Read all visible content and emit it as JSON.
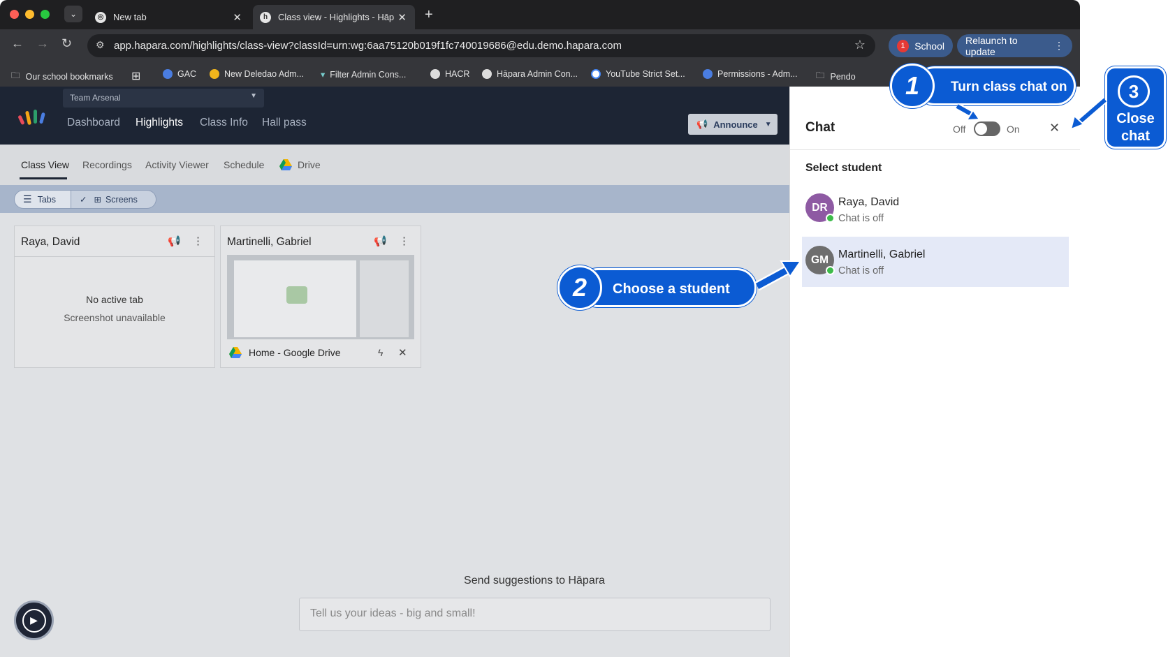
{
  "browser": {
    "tabs": [
      {
        "title": "New tab"
      },
      {
        "title": "Class view - Highlights - Hāp"
      }
    ],
    "url": "app.hapara.com/highlights/class-view?classId=urn:wg:6aa75120b019f1fc740019686@edu.demo.hapara.com",
    "profile_badge": "1",
    "profile_label": "School",
    "relaunch_label": "Relaunch to update",
    "bookmarks": [
      "Our school bookmarks",
      "GAC",
      "New Deledao Adm...",
      "Filter Admin Cons...",
      "HACR",
      "Hāpara Admin Con...",
      "YouTube Strict Set...",
      "Permissions - Adm...",
      "Pendo"
    ]
  },
  "app": {
    "team_select": "Team Arsenal",
    "nav": [
      "Dashboard",
      "Highlights",
      "Class Info",
      "Hall pass"
    ],
    "announce_label": "Announce",
    "subtabs": [
      "Class View",
      "Recordings",
      "Activity Viewer",
      "Schedule",
      "Drive"
    ],
    "view_toggle": {
      "tabs": "Tabs",
      "screens": "Screens"
    },
    "students": [
      {
        "name": "Raya, David",
        "empty_title": "No active tab",
        "empty_sub": "Screenshot unavailable"
      },
      {
        "name": "Martinelli, Gabriel",
        "tab_title": "Home - Google Drive"
      }
    ],
    "suggest_label": "Send suggestions to Hāpara",
    "suggest_placeholder": "Tell us your ideas - big and small!"
  },
  "chat": {
    "title": "Chat",
    "toggle_off": "Off",
    "toggle_on": "On",
    "toggle_state": "off",
    "select_label": "Select student",
    "students": [
      {
        "initials": "DR",
        "name": "Raya, David",
        "status": "Chat is off",
        "color": "#8e5aa3"
      },
      {
        "initials": "GM",
        "name": "Martinelli, Gabriel",
        "status": "Chat is off",
        "color": "#6e6e6e"
      }
    ]
  },
  "callouts": {
    "step1": {
      "num": "1",
      "text": "Turn class chat on"
    },
    "step2": {
      "num": "2",
      "text": "Choose a student"
    },
    "step3": {
      "num": "3",
      "line1": "Close",
      "line2": "chat"
    }
  },
  "colors": {
    "accent": "#0b5bd3",
    "header": "#1d2534",
    "online": "#3dbb4a"
  }
}
